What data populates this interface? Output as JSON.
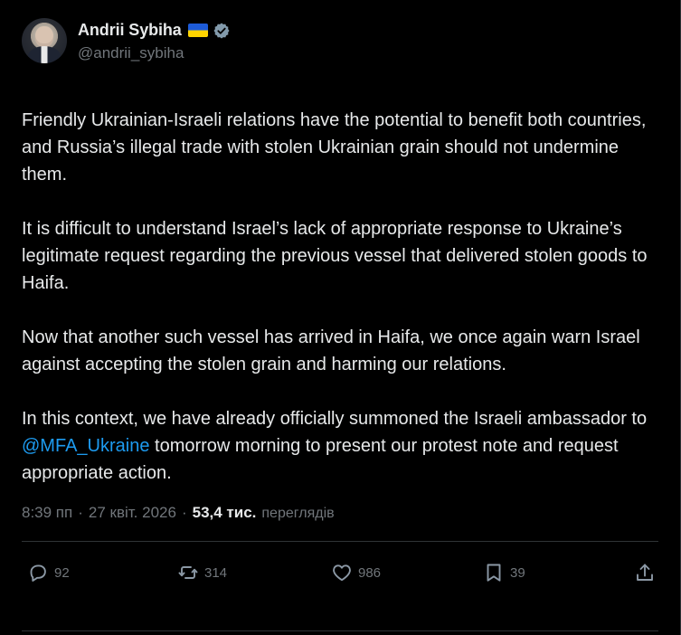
{
  "author": {
    "display_name": "Andrii Sybiha",
    "handle": "@andrii_sybiha",
    "flag": "ukraine-flag",
    "verified_icon": "verified-badge-icon"
  },
  "post": {
    "paragraphs": [
      "Friendly Ukrainian-Israeli relations have the potential to benefit both countries, and Russia’s illegal trade with stolen Ukrainian grain should not undermine them.",
      "It is difficult to understand Israel’s lack of appropriate response to Ukraine’s legitimate request regarding the previous vessel that delivered stolen goods to Haifa.",
      "Now that another such vessel has arrived in Haifa, we once again warn Israel against accepting the stolen grain and harming our relations."
    ],
    "last_paragraph": {
      "before": "In this context, we have already officially summoned the Israeli ambassador to ",
      "mention": "@MFA_Ukraine",
      "after": " tomorrow morning to present our protest note and request appropriate action."
    }
  },
  "meta": {
    "time": "8:39 пп",
    "separator": "·",
    "date": "27 квіт. 2026",
    "separator2": "·",
    "views_count": "53,4 тис.",
    "views_label": "переглядів"
  },
  "actions": {
    "replies": "92",
    "reposts": "314",
    "likes": "986",
    "bookmarks": "39"
  },
  "colors": {
    "background": "#000000",
    "text": "#e7e9ea",
    "muted": "#71767b",
    "link": "#1d9bf0",
    "divider": "#2f3336"
  }
}
